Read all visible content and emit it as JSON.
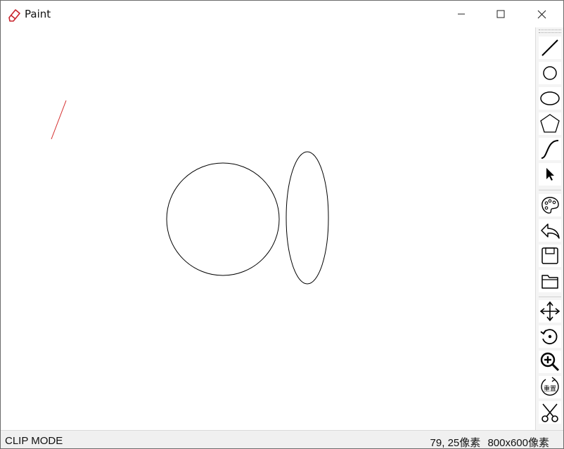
{
  "window": {
    "title": "Paint",
    "icon": "pencil-eraser-icon",
    "accent_color": "#c8232c"
  },
  "titlebar_buttons": [
    {
      "name": "minimize",
      "icon": "minimize-icon"
    },
    {
      "name": "maximize",
      "icon": "maximize-icon"
    },
    {
      "name": "close",
      "icon": "close-icon"
    }
  ],
  "canvas": {
    "background": "#ffffff",
    "shapes": [
      {
        "type": "line",
        "color": "#d42a2a"
      },
      {
        "type": "circle",
        "color": "#000000"
      },
      {
        "type": "ellipse",
        "color": "#000000"
      }
    ]
  },
  "toolbar": {
    "tools": [
      {
        "name": "line",
        "icon": "line-icon"
      },
      {
        "name": "circle",
        "icon": "circle-icon"
      },
      {
        "name": "ellipse",
        "icon": "ellipse-icon"
      },
      {
        "name": "polygon",
        "icon": "pentagon-icon"
      },
      {
        "name": "curve",
        "icon": "curve-icon"
      },
      {
        "name": "select",
        "icon": "cursor-icon"
      },
      {
        "name": "color",
        "icon": "palette-icon"
      },
      {
        "name": "undo",
        "icon": "undo-icon"
      },
      {
        "name": "save",
        "icon": "save-icon"
      },
      {
        "name": "open",
        "icon": "folder-icon"
      },
      {
        "name": "move",
        "icon": "move-icon"
      },
      {
        "name": "rotate",
        "icon": "rotate-icon"
      },
      {
        "name": "zoom",
        "icon": "zoom-in-icon"
      },
      {
        "name": "reset",
        "icon": "reset-icon",
        "label": "重置"
      },
      {
        "name": "clip",
        "icon": "scissors-icon"
      }
    ]
  },
  "status": {
    "mode": "CLIP MODE",
    "cursor": "79, 25像素",
    "size": "800x600像素"
  }
}
